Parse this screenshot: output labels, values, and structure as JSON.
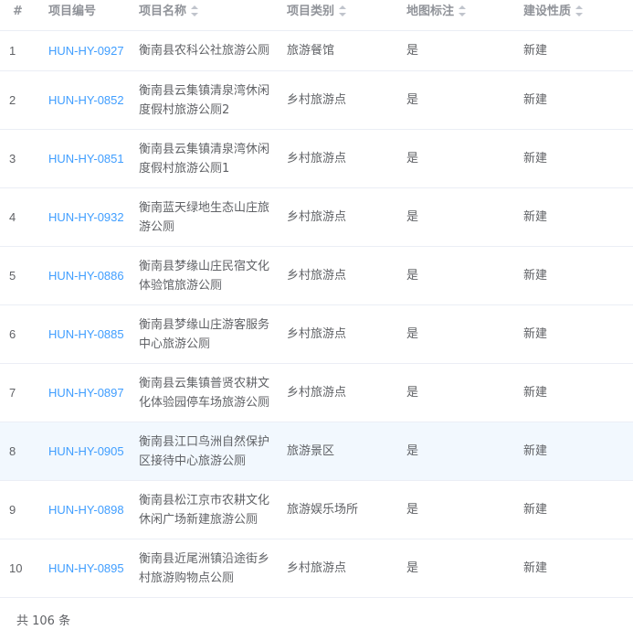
{
  "table": {
    "headers": {
      "index": "#",
      "code": "项目编号",
      "name": "项目名称",
      "type": "项目类别",
      "map_mark": "地图标注",
      "build_nature": "建设性质"
    },
    "rows": [
      {
        "index": "1",
        "code": "HUN-HY-0927",
        "name": "衡南县农科公社旅游公厕",
        "type": "旅游餐馆",
        "map_mark": "是",
        "build_nature": "新建"
      },
      {
        "index": "2",
        "code": "HUN-HY-0852",
        "name": "衡南县云集镇清泉湾休闲度假村旅游公厕2",
        "type": "乡村旅游点",
        "map_mark": "是",
        "build_nature": "新建"
      },
      {
        "index": "3",
        "code": "HUN-HY-0851",
        "name": "衡南县云集镇清泉湾休闲度假村旅游公厕1",
        "type": "乡村旅游点",
        "map_mark": "是",
        "build_nature": "新建"
      },
      {
        "index": "4",
        "code": "HUN-HY-0932",
        "name": "衡南蓝天绿地生态山庄旅游公厕",
        "type": "乡村旅游点",
        "map_mark": "是",
        "build_nature": "新建"
      },
      {
        "index": "5",
        "code": "HUN-HY-0886",
        "name": "衡南县梦缘山庄民宿文化体验馆旅游公厕",
        "type": "乡村旅游点",
        "map_mark": "是",
        "build_nature": "新建"
      },
      {
        "index": "6",
        "code": "HUN-HY-0885",
        "name": "衡南县梦缘山庄游客服务中心旅游公厕",
        "type": "乡村旅游点",
        "map_mark": "是",
        "build_nature": "新建"
      },
      {
        "index": "7",
        "code": "HUN-HY-0897",
        "name": "衡南县云集镇普贤农耕文化体验园停车场旅游公厕",
        "type": "乡村旅游点",
        "map_mark": "是",
        "build_nature": "新建"
      },
      {
        "index": "8",
        "code": "HUN-HY-0905",
        "name": "衡南县江口鸟洲自然保护区接待中心旅游公厕",
        "type": "旅游景区",
        "map_mark": "是",
        "build_nature": "新建"
      },
      {
        "index": "9",
        "code": "HUN-HY-0898",
        "name": "衡南县松江京市农耕文化休闲广场新建旅游公厕",
        "type": "旅游娱乐场所",
        "map_mark": "是",
        "build_nature": "新建"
      },
      {
        "index": "10",
        "code": "HUN-HY-0895",
        "name": "衡南县近尾洲镇沿途街乡村旅游购物点公厕",
        "type": "乡村旅游点",
        "map_mark": "是",
        "build_nature": "新建"
      }
    ],
    "hover_row": 8
  },
  "pagination": {
    "total_label": "共 106 条"
  },
  "colors": {
    "link": "#409eff",
    "text": "#606266",
    "header_text": "#909399",
    "border": "#ebeef5",
    "hover_bg": "#f2f8fe"
  }
}
